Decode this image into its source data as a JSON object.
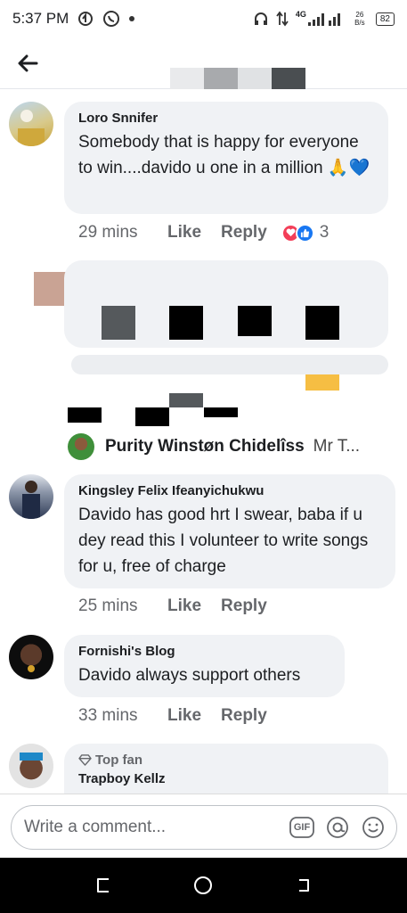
{
  "status_bar": {
    "time": "5:37 PM",
    "network": "4G",
    "speed": "26 B/s",
    "battery": "82"
  },
  "comments": [
    {
      "author": "Loro Snnifer",
      "text": "Somebody that is happy for everyone to win....davido u one in a million 🙏💙",
      "time": "29 mins",
      "like_label": "Like",
      "reply_label": "Reply",
      "reaction_count": "3"
    },
    {
      "author": "Kingsley Felix Ifeanyichukwu",
      "text": "Davido has good hrt I swear, baba if u dey read this I volunteer to write songs for u, free of charge",
      "time": "25 mins",
      "like_label": "Like",
      "reply_label": "Reply"
    },
    {
      "author": "Fornishi's Blog",
      "text": "Davido always support others",
      "time": "33 mins",
      "like_label": "Like",
      "reply_label": "Reply"
    },
    {
      "badge": "Top fan",
      "author": "Trapboy Kellz"
    }
  ],
  "reply_preview": {
    "name": "Purity Winstøn Chidelîss",
    "snippet": "Mr T..."
  },
  "composer": {
    "placeholder": "Write a comment...",
    "gif_label": "GIF"
  },
  "colors": {
    "bubble": "#f0f2f5",
    "meta_text": "#65676b",
    "like_blue": "#1877f2",
    "love_red": "#f33e58"
  }
}
